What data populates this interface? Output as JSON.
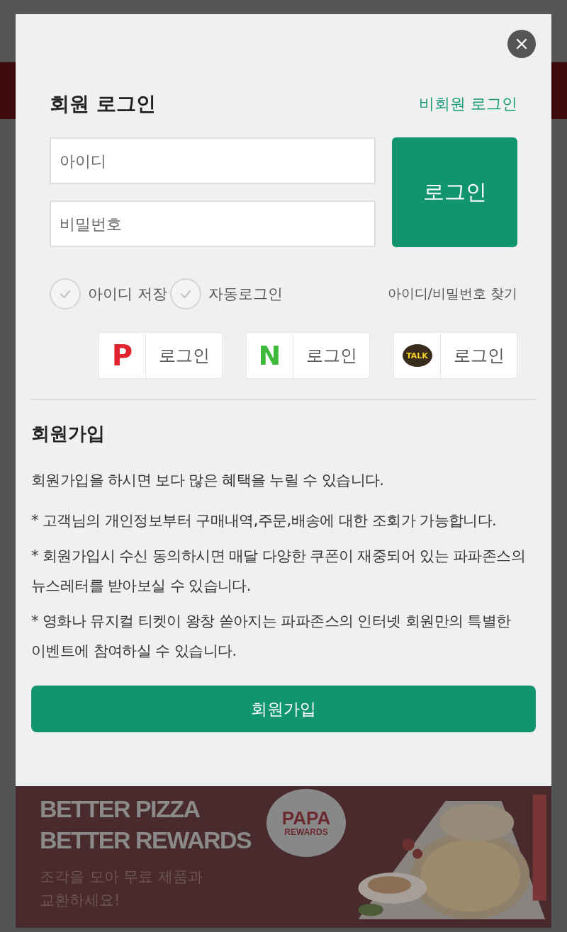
{
  "dialog": {
    "title": "회원 로그인",
    "guest_login_link": "비회원 로그인",
    "fields": [
      {
        "placeholder": "아이디"
      },
      {
        "placeholder": "비밀번호"
      }
    ],
    "login_button": "로그인",
    "options": [
      {
        "label": "아이디 저장",
        "checked": false
      },
      {
        "label": "자동로그인",
        "checked": false
      }
    ],
    "find_link": "아이디/비밀번호 찾기",
    "social_logins": [
      {
        "kind": "papa",
        "mark": "P",
        "label": "로그인"
      },
      {
        "kind": "naver",
        "mark": "N",
        "label": "로그인"
      },
      {
        "kind": "kakao",
        "mark": "TALK",
        "label": "로그인"
      }
    ],
    "signup": {
      "title": "회원가입",
      "intro": "회원가입을 하시면 보다 많은 혜택을 누릴 수 있습니다.",
      "notes": [
        "* 고객님의 개인정보부터 구매내역,주문,배송에 대한 조회가 가능합니다.",
        "* 회원가입시 수신 동의하시면 매달 다양한 쿠폰이 재중되어 있는 파파존스의 뉴스레터를 받아보실 수 있습니다.",
        "* 영화나 뮤지컬 티켓이 왕창 쏟아지는 파파존스의 인터넷 회원만의 특별한 이벤트에 참여하실 수 있습니다."
      ],
      "button": "회원가입"
    }
  },
  "banner": {
    "headline": [
      "BETTER PIZZA",
      "BETTER REWARDS"
    ],
    "badge": [
      "PAPA",
      "REWARDS"
    ],
    "subtitle": [
      "조각을 모아 무료 제품과",
      "교환하세요!"
    ],
    "image": {
      "kind": "picture"
    }
  }
}
